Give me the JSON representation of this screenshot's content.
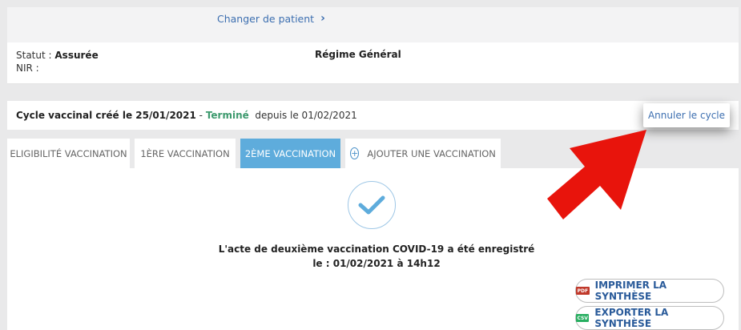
{
  "header": {
    "change_patient": "Changer de patient"
  },
  "patient": {
    "statut_label": "Statut :",
    "statut_value": "Assurée",
    "nir_label": "NIR :",
    "regime": "Régime Général"
  },
  "cycle": {
    "created_prefix": "Cycle vaccinal créé le 25/01/2021",
    "separator": " - ",
    "status": "Terminé",
    "since": "depuis le 01/02/2021",
    "cancel_label": "Annuler le cycle"
  },
  "tabs": [
    {
      "label": "ELIGIBILITÉ VACCINATION"
    },
    {
      "label": "1ÈRE VACCINATION"
    },
    {
      "label": "2ÈME VACCINATION"
    },
    {
      "label": "AJOUTER UNE VACCINATION"
    }
  ],
  "result": {
    "line1": "L'acte de deuxième vaccination COVID-19 a été enregistré",
    "line2": "le : 01/02/2021 à 14h12"
  },
  "actions": {
    "print_label": "IMPRIMER LA SYNTHÈSE",
    "export_label": "EXPORTER LA SYNTHÈSE",
    "pdf_badge": "PDF",
    "csv_badge": "CSV"
  },
  "colors": {
    "accent": "#5eacdc",
    "link": "#3d6fb0",
    "status_green": "#3d9a6e",
    "annotation_arrow": "#e8140c"
  }
}
